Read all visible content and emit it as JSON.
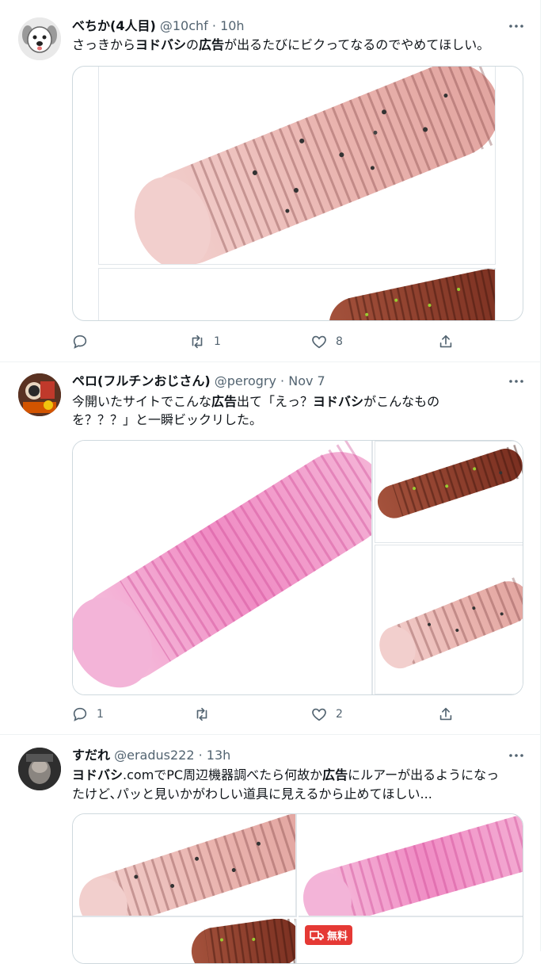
{
  "tweets": [
    {
      "display_name": "べちか(4人目)",
      "handle": "@10chf",
      "sep": " · ",
      "time": "10h",
      "text_segments": [
        "さっきから",
        "ヨドバシ",
        "の",
        "広告",
        "が出るたびにビクってなるのでやめてほしい。"
      ],
      "replies": "",
      "retweets": "1",
      "likes": "8"
    },
    {
      "display_name": "ペロ(フルチンおじさん)",
      "handle": "@perogry",
      "sep": " · ",
      "time": "Nov 7",
      "line1_segments": [
        "今開いたサイトでこんな",
        "広告",
        "出て「えっ？",
        "ヨドバシ",
        "がこんなもの"
      ],
      "line2": "を？？？」と一瞬ビックリした。",
      "replies": "1",
      "retweets": "",
      "likes": "2"
    },
    {
      "display_name": "すだれ",
      "handle": "@eradus222",
      "sep": " · ",
      "time": "13h",
      "line1_segments": [
        "ヨドバシ",
        ".comでPC周辺機器調べたら何故か",
        "広告",
        "にルアーが出るようになっ"
      ],
      "line2": "たけど､パッと見いかがわしい道具に見えるから止めてほしい...",
      "badge": "無料"
    }
  ],
  "colors": {
    "text": "#0f1419",
    "secondary": "#536471",
    "border": "#cfd9de",
    "lure_pink_clear": "#e8b4b0",
    "lure_pink": "#f08cc4",
    "lure_brown": "#8a3c2a",
    "badge_red": "#e53935"
  },
  "icons": [
    "more-icon",
    "reply-icon",
    "retweet-icon",
    "like-icon",
    "share-icon",
    "truck-icon"
  ]
}
